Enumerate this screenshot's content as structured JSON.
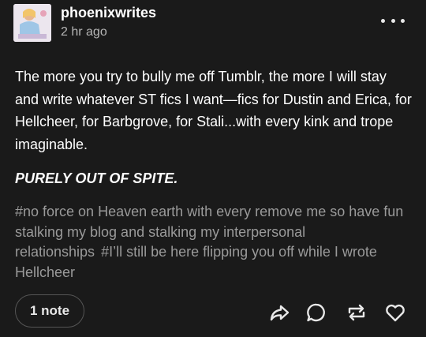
{
  "post": {
    "username": "phoenixwrites",
    "timestamp": "2 hr ago",
    "body": "The more you try to bully me off Tumblr, the more I will stay and write whatever ST fics I want—fics for Dustin and Erica, for Hellcheer, for Barbgrove, for Stali...with every kink and trope imaginable.",
    "emphasis": "PURELY OUT OF SPITE.",
    "tags": [
      "#no force on Heaven earth with every remove me so have fun stalking my blog and stalking my interpersonal relationships",
      "#I’ll still be here flipping you off while I wrote Hellcheer"
    ]
  },
  "footer": {
    "notes_label": "1 note"
  },
  "icons": {
    "more": "more-options-icon",
    "share": "share-icon",
    "reply": "reply-icon",
    "reblog": "reblog-icon",
    "like": "heart-icon"
  },
  "colors": {
    "background": "#1a1a1a",
    "text": "#ffffff",
    "secondary_text": "#b6b6b6",
    "tag_text": "#9a9a9a",
    "button_border": "#555555"
  }
}
